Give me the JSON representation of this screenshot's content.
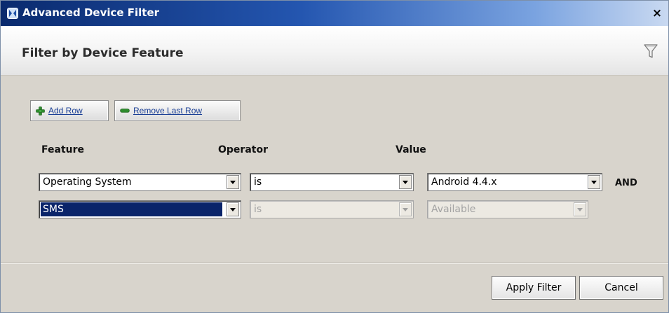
{
  "window": {
    "title": "Advanced Device Filter",
    "close_label": "×"
  },
  "header": {
    "title": "Filter by Device Feature"
  },
  "toolbar": {
    "add_row_label": "Add Row",
    "remove_row_label": "Remove Last Row"
  },
  "columns": {
    "feature": "Feature",
    "operator": "Operator",
    "value": "Value"
  },
  "rows": [
    {
      "feature": "Operating System",
      "operator": "is",
      "value": "Android 4.4.x",
      "conjunction": "AND",
      "enabled": true
    },
    {
      "feature": "SMS",
      "operator": "is",
      "value": "Available",
      "conjunction": "",
      "enabled": false
    }
  ],
  "footer": {
    "apply_label": "Apply Filter",
    "cancel_label": "Cancel"
  },
  "icons": {
    "title": "app-icon",
    "header": "funnel-icon",
    "add": "plus-icon",
    "remove": "minus-icon",
    "dropdown": "chevron-down-icon"
  },
  "colors": {
    "titlebar_start": "#0a2a6e",
    "titlebar_end": "#c9d9f1",
    "dialog_bg": "#d8d4cc",
    "selection": "#0a246a",
    "add_icon": "#2e8b2e",
    "link_text": "#1a3f96"
  }
}
